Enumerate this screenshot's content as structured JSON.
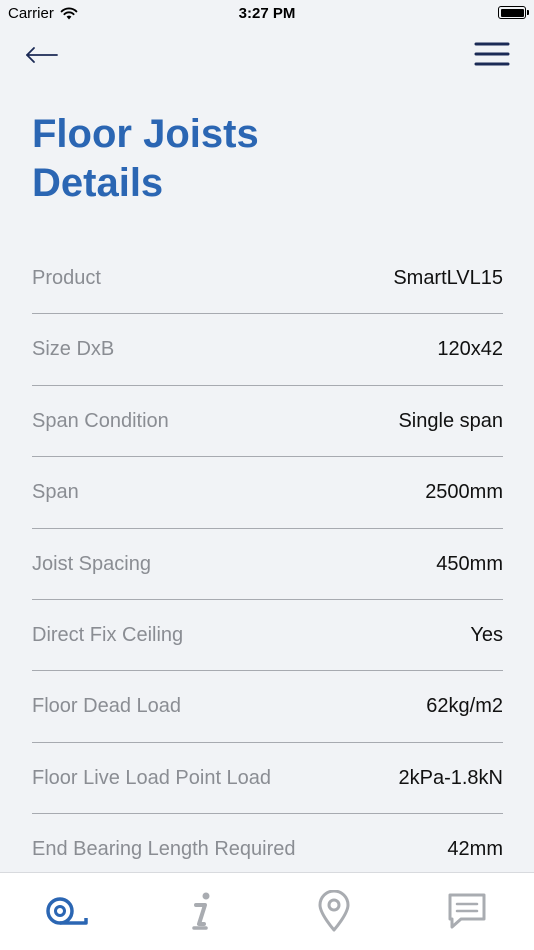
{
  "status_bar": {
    "carrier": "Carrier",
    "time": "3:27 PM"
  },
  "nav": {
    "back_icon": "arrow-left-icon",
    "menu_icon": "hamburger-menu-icon"
  },
  "page": {
    "title": "Floor Joists Details"
  },
  "details": [
    {
      "label": "Product",
      "value": "SmartLVL15"
    },
    {
      "label": "Size DxB",
      "value": "120x42"
    },
    {
      "label": "Span Condition",
      "value": "Single span"
    },
    {
      "label": "Span",
      "value": "2500mm"
    },
    {
      "label": "Joist Spacing",
      "value": "450mm"
    },
    {
      "label": "Direct Fix Ceiling",
      "value": "Yes"
    },
    {
      "label": "Floor Dead Load",
      "value": "62kg/m2"
    },
    {
      "label": "Floor Live Load Point Load",
      "value": "2kPa-1.8kN"
    },
    {
      "label": "End Bearing Length Required",
      "value": "42mm"
    }
  ],
  "tab_bar": {
    "tabs": [
      {
        "icon": "tape-measure-icon",
        "active": true
      },
      {
        "icon": "info-icon",
        "active": false
      },
      {
        "icon": "location-pin-icon",
        "active": false
      },
      {
        "icon": "message-icon",
        "active": false
      }
    ]
  },
  "colors": {
    "accent": "#2b66b3",
    "navy": "#1b2a55",
    "inactive_icon": "#a9acb1",
    "label": "#8a8d93",
    "divider": "#a7aab0",
    "background": "#f1f3f6"
  }
}
